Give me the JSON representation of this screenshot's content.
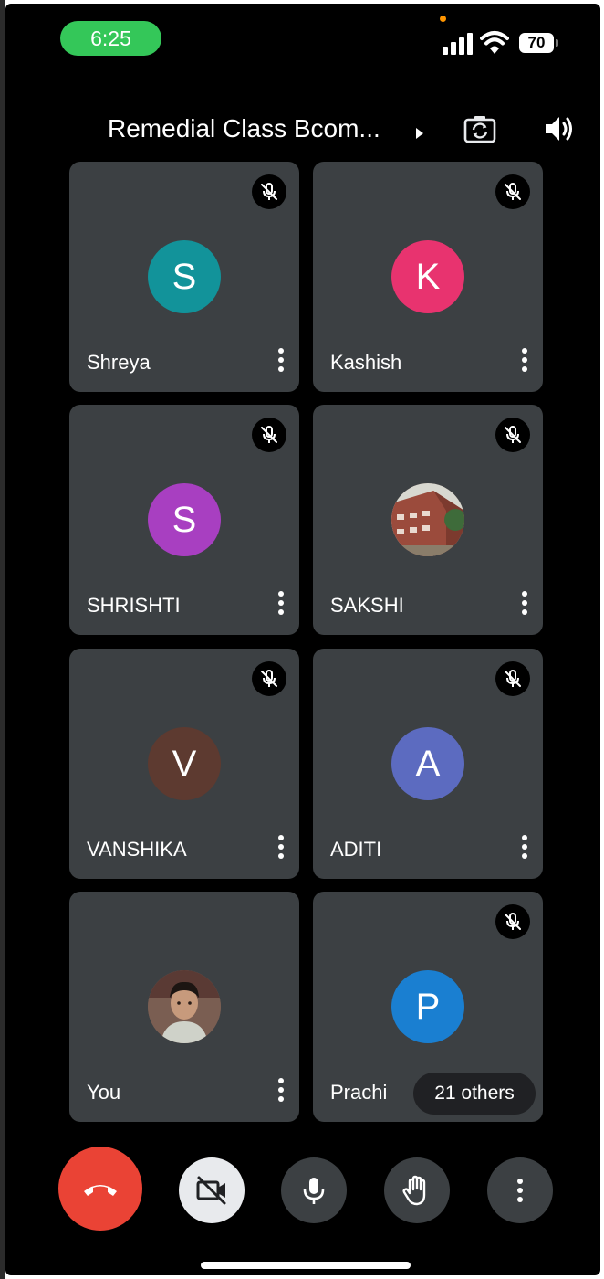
{
  "status_bar": {
    "time": "6:25",
    "battery": "70",
    "signal_icon": "cellular-signal-icon",
    "wifi_icon": "wifi-icon"
  },
  "header": {
    "title": "Remedial Class Bcom...",
    "title_arrow_icon": "chevron-right-icon",
    "switch_camera_icon": "switch-camera-icon",
    "audio_output_icon": "speaker-icon"
  },
  "participants": [
    {
      "name": "Shreya",
      "initial": "S",
      "avatar_color": "#12939a",
      "muted": true
    },
    {
      "name": "Kashish",
      "initial": "K",
      "avatar_color": "#e8336f",
      "muted": true
    },
    {
      "name": "SHRISHTI",
      "initial": "S",
      "avatar_color": "#a83fc1",
      "muted": true
    },
    {
      "name": "SAKSHI",
      "initial": "",
      "avatar_color": "#7a5a4a",
      "muted": true,
      "photo": "building-photo"
    },
    {
      "name": "VANSHIKA",
      "initial": "V",
      "avatar_color": "#5d3a30",
      "muted": true
    },
    {
      "name": "ADITI",
      "initial": "A",
      "avatar_color": "#5c6bc0",
      "muted": true
    },
    {
      "name": "You",
      "initial": "",
      "avatar_color": "#6b5a52",
      "muted": false,
      "photo": "profile-photo"
    },
    {
      "name": "Prachi",
      "initial": "P",
      "avatar_color": "#1a7fd1",
      "muted": true
    }
  ],
  "others_label": "21 others",
  "controls": {
    "end_call": "end-call-icon",
    "camera": "camera-off-icon",
    "microphone": "microphone-icon",
    "raise_hand": "raise-hand-icon",
    "more": "more-options-icon"
  },
  "colors": {
    "background": "#000000",
    "tile": "#3c4043",
    "end_call": "#ea4335",
    "status_pill": "#34c759"
  }
}
